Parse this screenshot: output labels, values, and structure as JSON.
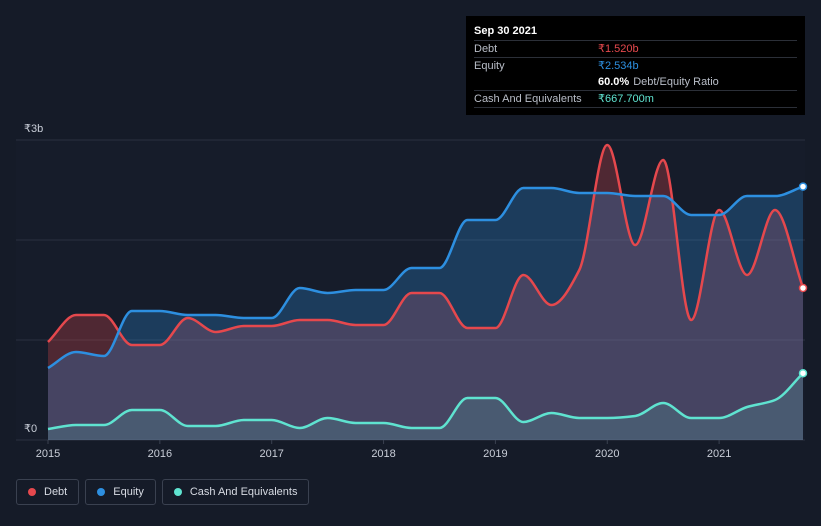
{
  "chart_data": {
    "type": "area",
    "ylim": [
      0,
      3.0
    ],
    "x": [
      2015.0,
      2015.25,
      2015.5,
      2015.75,
      2016.0,
      2016.25,
      2016.5,
      2016.75,
      2017.0,
      2017.25,
      2017.5,
      2017.75,
      2018.0,
      2018.25,
      2018.5,
      2018.75,
      2019.0,
      2019.25,
      2019.5,
      2019.75,
      2020.0,
      2020.25,
      2020.5,
      2020.75,
      2021.0,
      2021.25,
      2021.5,
      2021.75
    ],
    "x_ticks": [
      {
        "value": 2015,
        "label": "2015"
      },
      {
        "value": 2016,
        "label": "2016"
      },
      {
        "value": 2017,
        "label": "2017"
      },
      {
        "value": 2018,
        "label": "2018"
      },
      {
        "value": 2019,
        "label": "2019"
      },
      {
        "value": 2020,
        "label": "2020"
      },
      {
        "value": 2021,
        "label": "2021"
      }
    ],
    "y_ticks": [
      {
        "value": 0,
        "label": "₹0"
      },
      {
        "value": 3.0,
        "label": "₹3b"
      }
    ],
    "grid": true,
    "series": [
      {
        "name": "Debt",
        "color": "#e5484d",
        "values": [
          0.98,
          1.25,
          1.25,
          0.95,
          0.95,
          1.22,
          1.08,
          1.14,
          1.14,
          1.2,
          1.2,
          1.15,
          1.15,
          1.47,
          1.47,
          1.12,
          1.12,
          1.65,
          1.35,
          1.7,
          2.95,
          1.95,
          2.8,
          1.2,
          2.3,
          1.65,
          2.3,
          1.52
        ]
      },
      {
        "name": "Equity",
        "color": "#2d8fe0",
        "values": [
          0.72,
          0.88,
          0.84,
          1.29,
          1.29,
          1.25,
          1.25,
          1.22,
          1.22,
          1.52,
          1.47,
          1.5,
          1.5,
          1.72,
          1.72,
          2.2,
          2.2,
          2.52,
          2.52,
          2.47,
          2.47,
          2.44,
          2.44,
          2.25,
          2.25,
          2.44,
          2.44,
          2.534
        ]
      },
      {
        "name": "Cash And Equivalents",
        "color": "#5fe3d0",
        "values": [
          0.11,
          0.15,
          0.15,
          0.3,
          0.3,
          0.14,
          0.14,
          0.2,
          0.2,
          0.12,
          0.22,
          0.17,
          0.17,
          0.12,
          0.12,
          0.42,
          0.42,
          0.18,
          0.27,
          0.22,
          0.22,
          0.24,
          0.37,
          0.22,
          0.22,
          0.33,
          0.4,
          0.6677
        ]
      }
    ]
  },
  "tooltip": {
    "date": "Sep 30 2021",
    "rows": [
      {
        "label": "Debt",
        "value": "₹1.520b",
        "color": "#e5484d"
      },
      {
        "label": "Equity",
        "value": "₹2.534b",
        "color": "#2d8fe0"
      }
    ],
    "ratio_value": "60.0%",
    "ratio_label": "Debt/Equity Ratio",
    "cash": {
      "label": "Cash And Equivalents",
      "value": "₹667.700m",
      "color": "#5fe3d0"
    }
  },
  "legend": [
    {
      "label": "Debt",
      "color": "#e5484d"
    },
    {
      "label": "Equity",
      "color": "#2d8fe0"
    },
    {
      "label": "Cash And Equivalents",
      "color": "#5fe3d0"
    }
  ]
}
